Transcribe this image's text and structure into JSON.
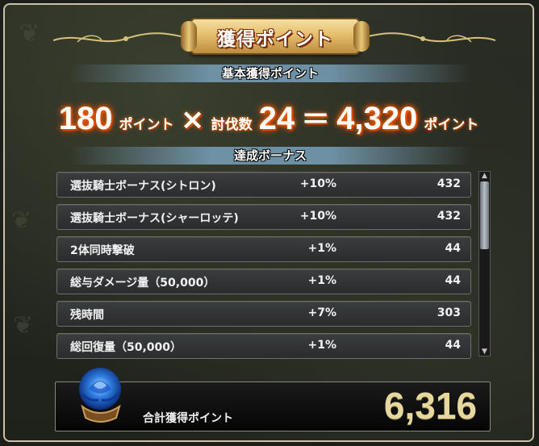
{
  "title": "獲得ポイント",
  "base": {
    "header": "基本獲得ポイント",
    "points": "180",
    "points_unit": "ポイント",
    "multiply": "×",
    "kills_label": "討伐数",
    "kills": "24",
    "equals": "＝",
    "result": "4,320",
    "result_unit": "ポイント"
  },
  "bonus": {
    "header": "達成ボーナス",
    "items": [
      {
        "name": "選抜騎士ボーナス(シトロン)",
        "percent": "+10%",
        "value": "432"
      },
      {
        "name": "選抜騎士ボーナス(シャーロッテ)",
        "percent": "+10%",
        "value": "432"
      },
      {
        "name": "2体同時撃破",
        "percent": "+1%",
        "value": "44"
      },
      {
        "name": "総与ダメージ量（50,000）",
        "percent": "+1%",
        "value": "44"
      },
      {
        "name": "残時間",
        "percent": "+7%",
        "value": "303"
      },
      {
        "name": "総回復量（50,000）",
        "percent": "+1%",
        "value": "44"
      }
    ]
  },
  "total": {
    "label": "合計獲得ポイント",
    "value": "6,316"
  },
  "icons": {
    "rose": "blue-rose-icon",
    "scroll_up": "arrow-up-icon",
    "scroll_down": "arrow-down-icon"
  },
  "colors": {
    "glow": "#ff6a00",
    "total_value": "#e6d79f"
  }
}
